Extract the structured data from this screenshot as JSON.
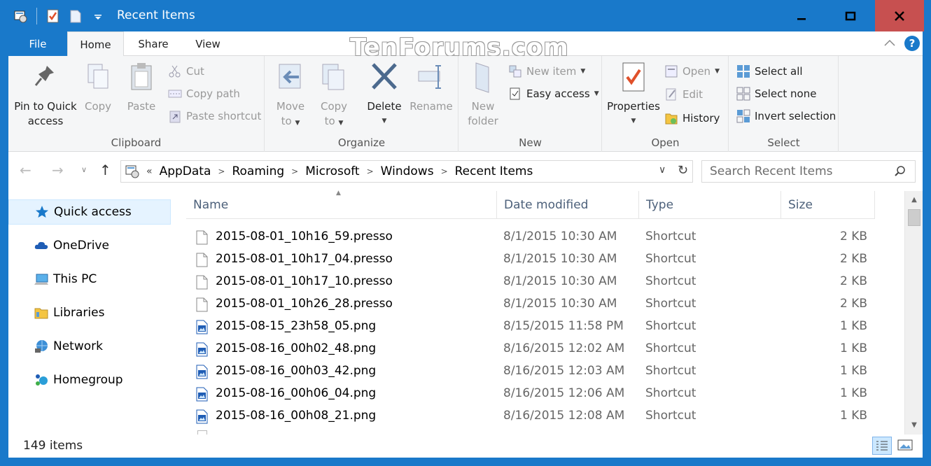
{
  "window": {
    "title": "Recent Items"
  },
  "watermark": "TenForums.com",
  "tabs": {
    "file": "File",
    "home": "Home",
    "share": "Share",
    "view": "View"
  },
  "help_label": "?",
  "ribbon": {
    "clipboard": {
      "label": "Clipboard",
      "pin_line1": "Pin to Quick",
      "pin_line2": "access",
      "copy": "Copy",
      "paste": "Paste",
      "cut": "Cut",
      "copy_path": "Copy path",
      "paste_shortcut": "Paste shortcut"
    },
    "organize": {
      "label": "Organize",
      "move_line1": "Move",
      "move_line2": "to",
      "copy_line1": "Copy",
      "copy_line2": "to",
      "delete": "Delete",
      "rename": "Rename"
    },
    "new": {
      "label": "New",
      "folder_line1": "New",
      "folder_line2": "folder",
      "new_item": "New item",
      "easy_access": "Easy access"
    },
    "open": {
      "label": "Open",
      "properties": "Properties",
      "open": "Open",
      "edit": "Edit",
      "history": "History"
    },
    "select": {
      "label": "Select",
      "select_all": "Select all",
      "select_none": "Select none",
      "invert": "Invert selection"
    }
  },
  "address": {
    "overflow": "«",
    "crumbs": [
      "AppData",
      "Roaming",
      "Microsoft",
      "Windows",
      "Recent Items"
    ],
    "search_placeholder": "Search Recent Items"
  },
  "nav": {
    "items": [
      "Quick access",
      "OneDrive",
      "This PC",
      "Libraries",
      "Network",
      "Homegroup"
    ]
  },
  "columns": {
    "name": "Name",
    "date": "Date modified",
    "type": "Type",
    "size": "Size"
  },
  "files": [
    {
      "name": "2015-08-01_10h16_59.presso",
      "date": "8/1/2015 10:30 AM",
      "type": "Shortcut",
      "size": "2 KB",
      "icon": "blank-file-icon"
    },
    {
      "name": "2015-08-01_10h17_04.presso",
      "date": "8/1/2015 10:30 AM",
      "type": "Shortcut",
      "size": "2 KB",
      "icon": "blank-file-icon"
    },
    {
      "name": "2015-08-01_10h17_10.presso",
      "date": "8/1/2015 10:30 AM",
      "type": "Shortcut",
      "size": "2 KB",
      "icon": "blank-file-icon"
    },
    {
      "name": "2015-08-01_10h26_28.presso",
      "date": "8/1/2015 10:30 AM",
      "type": "Shortcut",
      "size": "2 KB",
      "icon": "blank-file-icon"
    },
    {
      "name": "2015-08-15_23h58_05.png",
      "date": "8/15/2015 11:58 PM",
      "type": "Shortcut",
      "size": "1 KB",
      "icon": "image-file-icon"
    },
    {
      "name": "2015-08-16_00h02_48.png",
      "date": "8/16/2015 12:02 AM",
      "type": "Shortcut",
      "size": "1 KB",
      "icon": "image-file-icon"
    },
    {
      "name": "2015-08-16_00h03_42.png",
      "date": "8/16/2015 12:03 AM",
      "type": "Shortcut",
      "size": "1 KB",
      "icon": "image-file-icon"
    },
    {
      "name": "2015-08-16_00h06_04.png",
      "date": "8/16/2015 12:06 AM",
      "type": "Shortcut",
      "size": "1 KB",
      "icon": "image-file-icon"
    },
    {
      "name": "2015-08-16_00h08_21.png",
      "date": "8/16/2015 12:08 AM",
      "type": "Shortcut",
      "size": "1 KB",
      "icon": "image-file-icon"
    }
  ],
  "status": {
    "count": "149 items"
  },
  "colors": {
    "accent": "#1979ca",
    "close": "#c75050",
    "selection": "#e5f3ff"
  }
}
